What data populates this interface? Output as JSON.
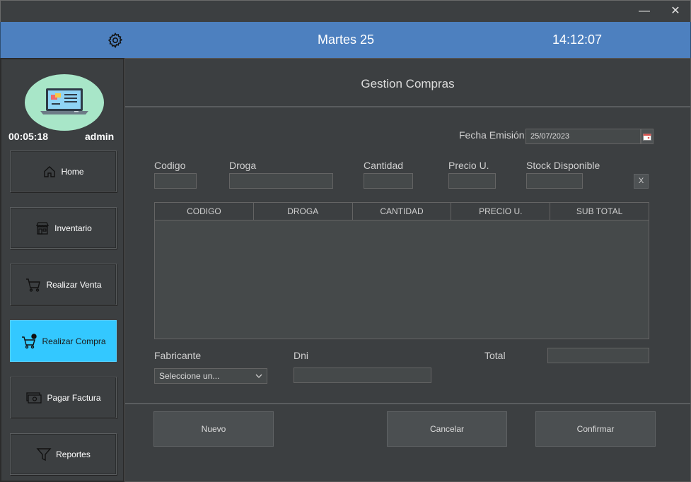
{
  "window": {
    "minimize": "—",
    "close": "✕"
  },
  "header": {
    "day": "Martes 25",
    "clock": "14:12:07"
  },
  "session": {
    "elapsed": "00:05:18",
    "user": "admin"
  },
  "nav": {
    "home": "Home",
    "inventario": "Inventario",
    "venta": "Realizar Venta",
    "compra": "Realizar Compra",
    "factura": "Pagar Factura",
    "reportes": "Reportes"
  },
  "page": {
    "title": "Gestion Compras"
  },
  "form": {
    "fecha_label": "Fecha Emisión:",
    "fecha_value": "25/07/2023",
    "codigo_label": "Codigo",
    "droga_label": "Droga",
    "cantidad_label": "Cantidad",
    "precio_label": "Precio U.",
    "stock_label": "Stock Disponible",
    "clear_label": "X",
    "fabricante_label": "Fabricante",
    "fabricante_selected": "Seleccione un...",
    "dni_label": "Dni",
    "total_label": "Total"
  },
  "table": {
    "columns": [
      "CODIGO",
      "DROGA",
      "CANTIDAD",
      "PRECIO U.",
      "SUB TOTAL"
    ],
    "rows": []
  },
  "actions": {
    "nuevo": "Nuevo",
    "cancelar": "Cancelar",
    "confirmar": "Confirmar"
  },
  "colors": {
    "accent_bar": "#4d80bf",
    "active_nav": "#33c8ff",
    "background": "#3c3f41"
  }
}
